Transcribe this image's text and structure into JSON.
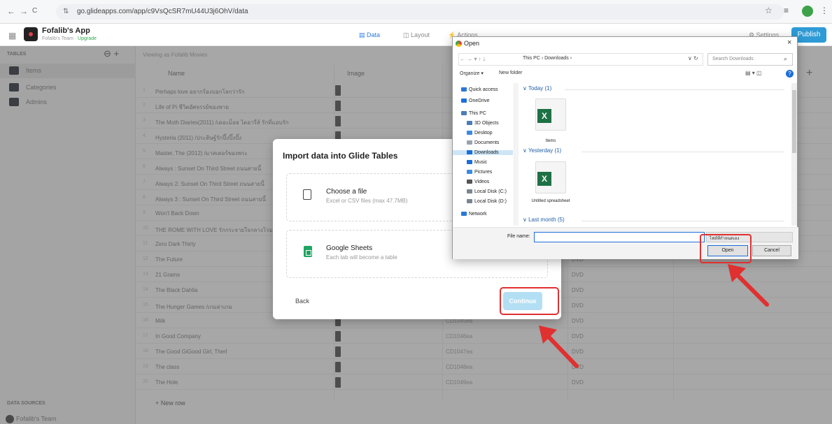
{
  "browser": {
    "url": "go.glideapps.com/app/c9VsQcSR7mU44U3j6OhV/data",
    "back": "←",
    "forward": "→",
    "reload": "C"
  },
  "app": {
    "name": "Fofalib's App",
    "team": "Fofalib's Team ·",
    "upgrade": "Upgrade",
    "tabs": [
      "Data",
      "Layout",
      "Actions"
    ],
    "settings": "Settings",
    "publish": "Publish"
  },
  "sidebar": {
    "tables_header": "TABLES",
    "items": [
      {
        "label": "Items"
      },
      {
        "label": "Categories"
      },
      {
        "label": "Admins"
      }
    ],
    "data_sources": "DATA SOURCES",
    "team": "Fofalib's Team"
  },
  "table": {
    "viewing": "Viewing as Fofalib Movies",
    "columns": [
      "Name",
      "Image"
    ],
    "rows": [
      {
        "name": "Perhaps love อยากร้องบอกโลกว่ารัก",
        "code": "",
        "media": ""
      },
      {
        "name": "Life of Pi ชีวิตอัศจรรย์ของพาย",
        "code": "",
        "media": ""
      },
      {
        "name": "The Moth Diaries(2011) /เดอะม็อธ ไดอารี่ส์ รักที่แอบรัก",
        "code": "",
        "media": ""
      },
      {
        "name": "Hysteria (2011) /ประดิษฐ์รักปิ๊งปิ๊งปั๊ง",
        "code": "",
        "media": ""
      },
      {
        "name": "Master, The (2012) /มาสเตอร์ของพระ",
        "code": "",
        "media": ""
      },
      {
        "name": "Always : Sunset On Third Street ถนนสายนี้",
        "code": "",
        "media": ""
      },
      {
        "name": "Always 2: Sunset On Third Street ถนนสายนี้",
        "code": "",
        "media": ""
      },
      {
        "name": "Always 3 : Sunset On Third Street ถนนสายนี้",
        "code": "",
        "media": ""
      },
      {
        "name": "Won't Back Down",
        "code": "",
        "media": ""
      },
      {
        "name": "THE ROME WITH LOVE รักกระจายใจกลางโรม",
        "code": "",
        "media": ""
      },
      {
        "name": "Zero Dark Thirty",
        "code": "",
        "media": ""
      },
      {
        "name": "The Future",
        "code": "",
        "media": "DVD"
      },
      {
        "name": "21 Grams",
        "code": "",
        "media": "DVD"
      },
      {
        "name": "The Black Dahlia",
        "code": "",
        "media": "DVD"
      },
      {
        "name": "The Hunger Games /เกมล่าเกม",
        "code": "",
        "media": "DVD"
      },
      {
        "name": "Milk",
        "code": "CD1045ea",
        "media": "DVD"
      },
      {
        "name": "In Good Company",
        "code": "CD1046ea",
        "media": "DVD"
      },
      {
        "name": "The Good GiGood Girl, Therl",
        "code": "CD1047ea",
        "media": "DVD"
      },
      {
        "name": "The class",
        "code": "CD1048ea",
        "media": "DVD"
      },
      {
        "name": "The Hole",
        "code": "CD1049ea",
        "media": "DVD"
      }
    ],
    "new_row": "+ New row"
  },
  "import_modal": {
    "title": "Import data into Glide Tables",
    "option_file_title": "Choose a file",
    "option_file_sub": "Excel or CSV files (max 47.7MB)",
    "option_sheets_title": "Google Sheets",
    "option_sheets_sub": "Each tab will become a table",
    "back": "Back",
    "continue": "Continue"
  },
  "open_dialog": {
    "title": "Open",
    "close": "×",
    "path": "This PC  ›  Downloads  ›",
    "search_placeholder": "Search Downloads",
    "organize": "Organize ▾",
    "new_folder": "New folder",
    "tree": [
      {
        "label": "Quick access",
        "color": "#2a78d6"
      },
      {
        "label": "OneDrive",
        "color": "#1d6ed9"
      },
      {
        "label": "This PC",
        "color": "#4a7db8"
      },
      {
        "label": "3D Objects",
        "color": "#4a7db8"
      },
      {
        "label": "Desktop",
        "color": "#3b8be0"
      },
      {
        "label": "Documents",
        "color": "#9aa3ad"
      },
      {
        "label": "Downloads",
        "color": "#1d6ed9"
      },
      {
        "label": "Music",
        "color": "#1d6ed9"
      },
      {
        "label": "Pictures",
        "color": "#3b8be0"
      },
      {
        "label": "Videos",
        "color": "#555"
      },
      {
        "label": "Local Disk (C:)",
        "color": "#7a8590"
      },
      {
        "label": "Local Disk (D:)",
        "color": "#7a8590"
      },
      {
        "label": "Network",
        "color": "#2a78d6"
      }
    ],
    "groups": [
      {
        "label": "Today (1)"
      },
      {
        "label": "Yesterday (1)"
      },
      {
        "label": "Last month (5)"
      }
    ],
    "files": [
      {
        "label": "Items",
        "badge": "X"
      },
      {
        "label": "Untitled spreadsheet",
        "badge": "X"
      }
    ],
    "file_name_label": "File name:",
    "file_type": "ไฟล์ที่กำหนดเอง",
    "open": "Open",
    "cancel": "Cancel"
  },
  "colors": {
    "accent": "#2b7be0",
    "publish": "#2e9bd6",
    "highlight": "#e03030",
    "excel": "#1e7145"
  }
}
